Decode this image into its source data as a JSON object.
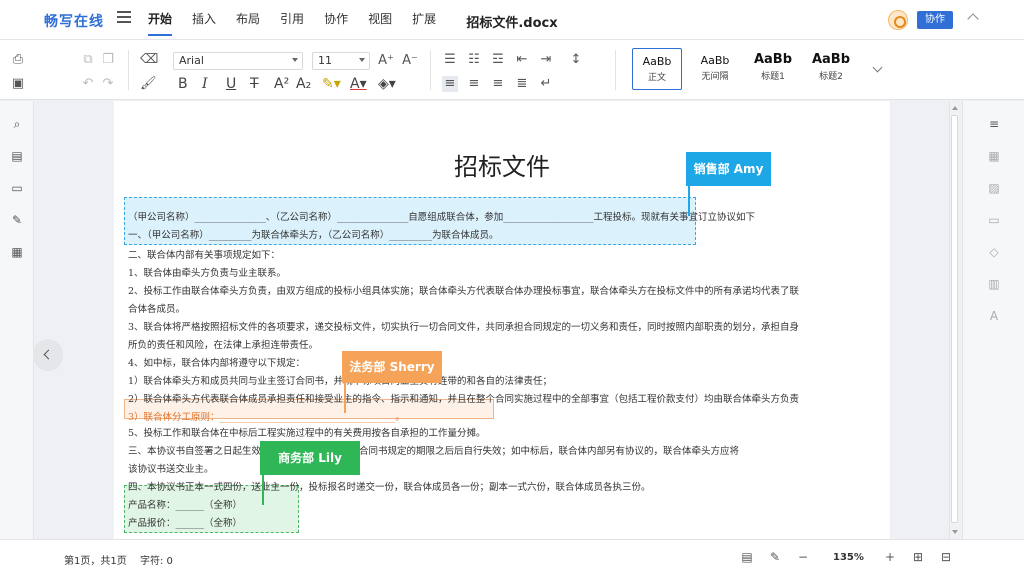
{
  "app": {
    "logo": "畅写在线",
    "doc_title": "招标文件.docx",
    "collab_button": "协作"
  },
  "menu": [
    {
      "label": "开始",
      "active": true
    },
    {
      "label": "插入"
    },
    {
      "label": "布局"
    },
    {
      "label": "引用"
    },
    {
      "label": "协作"
    },
    {
      "label": "视图"
    },
    {
      "label": "扩展"
    }
  ],
  "toolbar": {
    "font_family": "Arial",
    "font_size": "11",
    "styles": [
      {
        "sample": "AaBb",
        "name": "正文"
      },
      {
        "sample": "AaBb",
        "name": "无间隔"
      },
      {
        "sample": "AaBb",
        "name": "标题1"
      },
      {
        "sample": "AaBb",
        "name": "标题2"
      }
    ]
  },
  "document": {
    "title": "招标文件",
    "lines": [
      "（甲公司名称）_______________、（乙公司名称）_______________自愿组成联合体，参加___________________工程投标。现就有关事宜订立协议如下",
      "一、（甲公司名称）_________为联合体牵头方，（乙公司名称）_________为联合体成员。",
      "二、联合体内部有关事项规定如下：",
      "1、联合体由牵头方负责与业主联系。",
      "2、投标工作由联合体牵头方负责，由双方组成的投标小组具体实施；联合体牵头方代表联合体办理投标事宜，联合体牵头方在投标文件中的所有承诺均代表了联",
      "合体各成员。",
      "3、联合体将严格按照招标文件的各项要求，递交投标文件，切实执行一切合同文件，共同承担合同规定的一切义务和责任，同时按照内部职责的划分，承担自身",
      "所负的责任和风险，在法律上承担连带责任。",
      "4、如中标，联合体内部将遵守以下规定：",
      "1）联合体牵头方和成员共同与业主签订合同书，并就中标项目向业主负有连带的和各自的法律责任；",
      "2）联合体牵头方代表联合体成员承担责任和接受业主的指令、指示和通知，并且在整个合同实施过程中的全部事宜（包括工程价款支付）均由联合体牵头方负责",
      "3）联合体分工原则：_____________________________________。",
      "5、投标工作和联合体在中标后工程实施过程中的有关费用按各自承担的工作量分摊。",
      "三、本协议书自签署之日起生效，至（______）  所述的合同书规定的期限之后后自行失效；如中标后，联合体内部另有协议的，联合体牵头方应将",
      "该协议书送交业主。",
      "四、本协议书正本一式四份，送业主一份，投标报名时递交一份，联合体成员各一份；副本一式六份，联合体成员各执三份。",
      "产品名称：______（全称）",
      "产品报价：______（全称）"
    ]
  },
  "collaborators": [
    {
      "name": "销售部 Amy",
      "color": "#1ea7e6"
    },
    {
      "name": "法务部 Sherry",
      "color": "#f6a35a"
    },
    {
      "name": "商务部 Lily",
      "color": "#2fb757"
    }
  ],
  "status": {
    "page_info": "第1页，共1页",
    "word_count": "字符: 0",
    "zoom": "135%"
  }
}
